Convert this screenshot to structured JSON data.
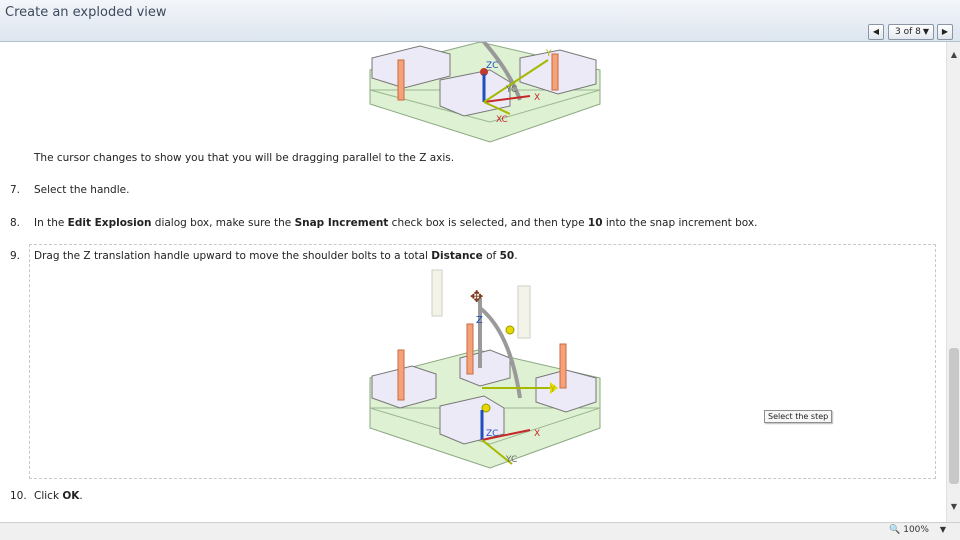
{
  "window": {
    "title": "Create an exploded view"
  },
  "nav": {
    "prev_icon": "left-triangle-icon",
    "next_icon": "right-triangle-icon",
    "page_indicator": "3 of 8",
    "dropdown_icon": "chevron-down-icon"
  },
  "content": {
    "intro_text": "The cursor changes to show you that you will be dragging parallel to the Z axis.",
    "steps": [
      {
        "num": "7.",
        "parts": [
          "Select the handle."
        ]
      },
      {
        "num": "8.",
        "parts": [
          "In the ",
          "Edit Explosion",
          " dialog box, make sure the ",
          "Snap Increment",
          " check box is selected, and then type ",
          "10",
          " into the snap increment box."
        ]
      },
      {
        "num": "9.",
        "parts": [
          "Drag the Z translation handle upward to move the shoulder bolts to a total ",
          "Distance",
          " of ",
          "50",
          "."
        ]
      },
      {
        "num": "10.",
        "parts": [
          "Click ",
          "OK",
          "."
        ]
      }
    ],
    "figure_labels": {
      "z": "Z",
      "zc": "ZC",
      "y": "Y",
      "yc": "YC",
      "x": "X",
      "xc": "XC"
    },
    "tooltip": "Select the step"
  },
  "statusbar": {
    "zoom": "100%"
  },
  "colors": {
    "base": "#dff1d3",
    "block": "#eceaf6",
    "bolt": "#f5a27a",
    "axis_x": "#c62828",
    "axis_y": "#a6b800",
    "axis_z": "#1f4fbf"
  }
}
